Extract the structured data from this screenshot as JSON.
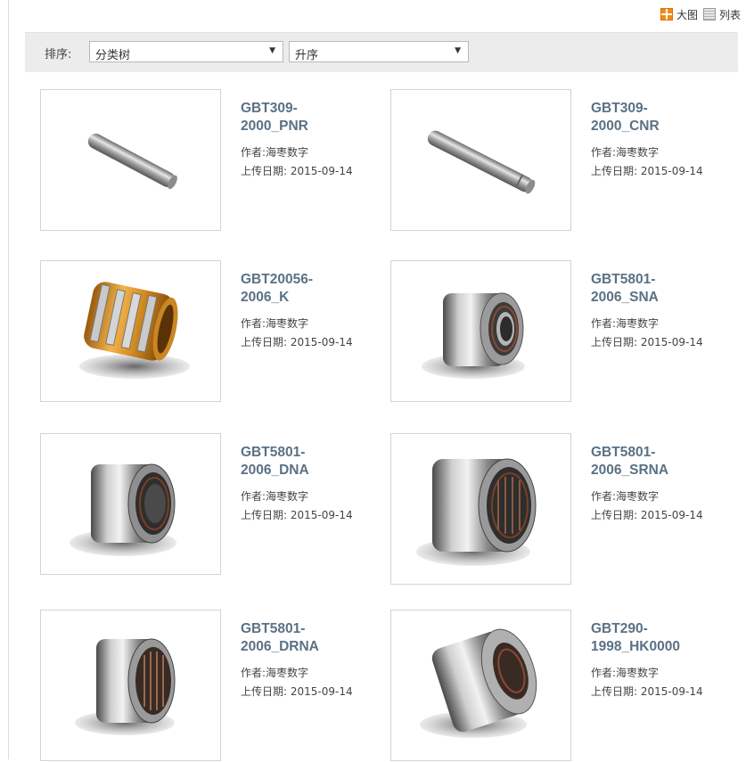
{
  "view_switch": {
    "grid_label": "大图",
    "list_label": "列表"
  },
  "toolbar": {
    "sort_label": "排序:",
    "category_select": {
      "value": "分类树"
    },
    "order_select": {
      "value": "升序"
    }
  },
  "items": [
    {
      "title_line1": "GBT309-",
      "title_line2": "2000_PNR",
      "author": "作者:海枣数字",
      "upload_date": "上传日期: 2015-09-14",
      "icon": "pin-icon"
    },
    {
      "title_line1": "GBT309-",
      "title_line2": "2000_CNR",
      "author": "作者:海枣数字",
      "upload_date": "上传日期: 2015-09-14",
      "icon": "pin-icon"
    },
    {
      "title_line1": "GBT20056-",
      "title_line2": "2006_K",
      "author": "作者:海枣数字",
      "upload_date": "上传日期: 2015-09-14",
      "icon": "cage-bearing-icon"
    },
    {
      "title_line1": "GBT5801-",
      "title_line2": "2006_SNA",
      "author": "作者:海枣数字",
      "upload_date": "上传日期: 2015-09-14",
      "icon": "bearing-icon"
    },
    {
      "title_line1": "GBT5801-",
      "title_line2": "2006_DNA",
      "author": "作者:海枣数字",
      "upload_date": "上传日期: 2015-09-14",
      "icon": "bearing-icon"
    },
    {
      "title_line1": "GBT5801-",
      "title_line2": "2006_SRNA",
      "author": "作者:海枣数字",
      "upload_date": "上传日期: 2015-09-14",
      "icon": "bearing-icon"
    },
    {
      "title_line1": "GBT5801-",
      "title_line2": "2006_DRNA",
      "author": "作者:海枣数字",
      "upload_date": "上传日期: 2015-09-14",
      "icon": "bearing-icon"
    },
    {
      "title_line1": "GBT290-",
      "title_line2": "1998_HK0000",
      "author": "作者:海枣数字",
      "upload_date": "上传日期: 2015-09-14",
      "icon": "bearing-icon"
    }
  ],
  "colors": {
    "title": "#5b7184",
    "toolbar_bg": "#ececec",
    "grid_icon": "#f08a1c"
  }
}
